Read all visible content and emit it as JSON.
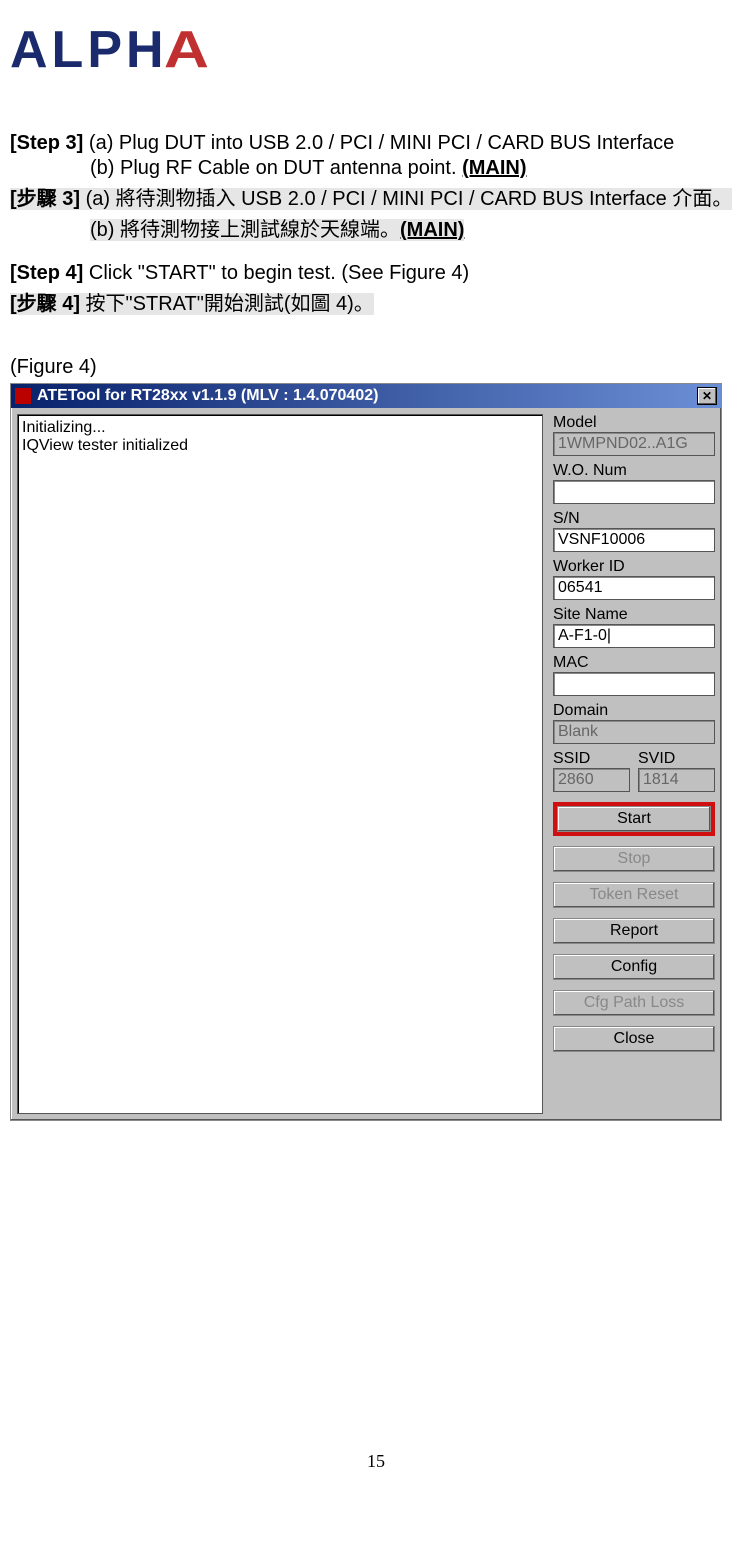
{
  "logo": {
    "text_pre": "ALPH",
    "text_post": "A",
    "lambda": "A"
  },
  "step3": {
    "label": "[Step 3]",
    "a": "(a) Plug DUT into USB 2.0 / PCI / MINI PCI / CARD BUS Interface",
    "b_pre": "(b) Plug RF Cable on DUT antenna point. ",
    "b_main": "(MAIN)"
  },
  "step3_cn": {
    "label": "[步驟 3]",
    "a": "(a)  將待測物插入 USB 2.0 / PCI / MINI PCI / CARD BUS Interface  介面。",
    "b_pre": "(b)  將待測物接上測試線於天線端。",
    "b_main": "(MAIN)"
  },
  "step4": {
    "label": "[Step 4]",
    "text": "Click \"START\" to begin test. (See Figure 4)"
  },
  "step4_cn": {
    "label": "[步驟 4]",
    "text": "  按下\"STRAT\"開始測試(如圖 4)。"
  },
  "figure_caption": "(Figure 4)",
  "window": {
    "title": "ATETool for RT28xx v1.1.9 (MLV : 1.4.070402)",
    "close_glyph": "✕",
    "log": "Initializing...\nIQView tester initialized",
    "fields": {
      "model_label": "Model",
      "model_value": "1WMPND02..A1G",
      "wonum_label": "W.O. Num",
      "wonum_value": "",
      "sn_label": "S/N",
      "sn_value": "VSNF10006",
      "worker_label": "Worker ID",
      "worker_value": "06541",
      "site_label": "Site Name",
      "site_value": "A-F1-0|",
      "mac_label": "MAC",
      "mac_value": "",
      "domain_label": "Domain",
      "domain_value": "Blank",
      "ssid_label": "SSID",
      "ssid_value": "2860",
      "svid_label": "SVID",
      "svid_value": "1814"
    },
    "buttons": {
      "start": "Start",
      "stop": "Stop",
      "token_reset": "Token Reset",
      "report": "Report",
      "config": "Config",
      "cfg_path_loss": "Cfg Path Loss",
      "close": "Close"
    }
  },
  "page_number": "15"
}
